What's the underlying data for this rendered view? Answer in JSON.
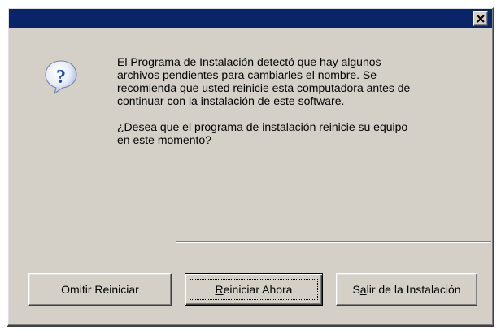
{
  "window": {
    "title": ""
  },
  "dialog": {
    "icon": "question-icon",
    "message_lines_1": [
      "El Programa de Instalación detectó que hay algunos",
      "archivos pendientes para cambiarles el nombre. Se",
      "recomienda que usted reinicie esta computadora antes de",
      "continuar con la instalación de este software."
    ],
    "message_lines_2": [
      "¿Desea que el programa de instalación reinicie su equipo",
      "en este momento?"
    ]
  },
  "buttons": {
    "skip": {
      "label": "Omitir Reiniciar"
    },
    "restart": {
      "label_access_key": "R",
      "label_rest": "einiciar Ahora",
      "label": "Reiniciar Ahora"
    },
    "exit": {
      "label_before": "S",
      "label_access_key": "a",
      "label_after": "lir de la Instalación",
      "label": "Salir de la Instalación"
    }
  },
  "colors": {
    "titlebar": "#0a246a",
    "face": "#d4d0c8",
    "icon_blue": "#1f4fb4"
  }
}
